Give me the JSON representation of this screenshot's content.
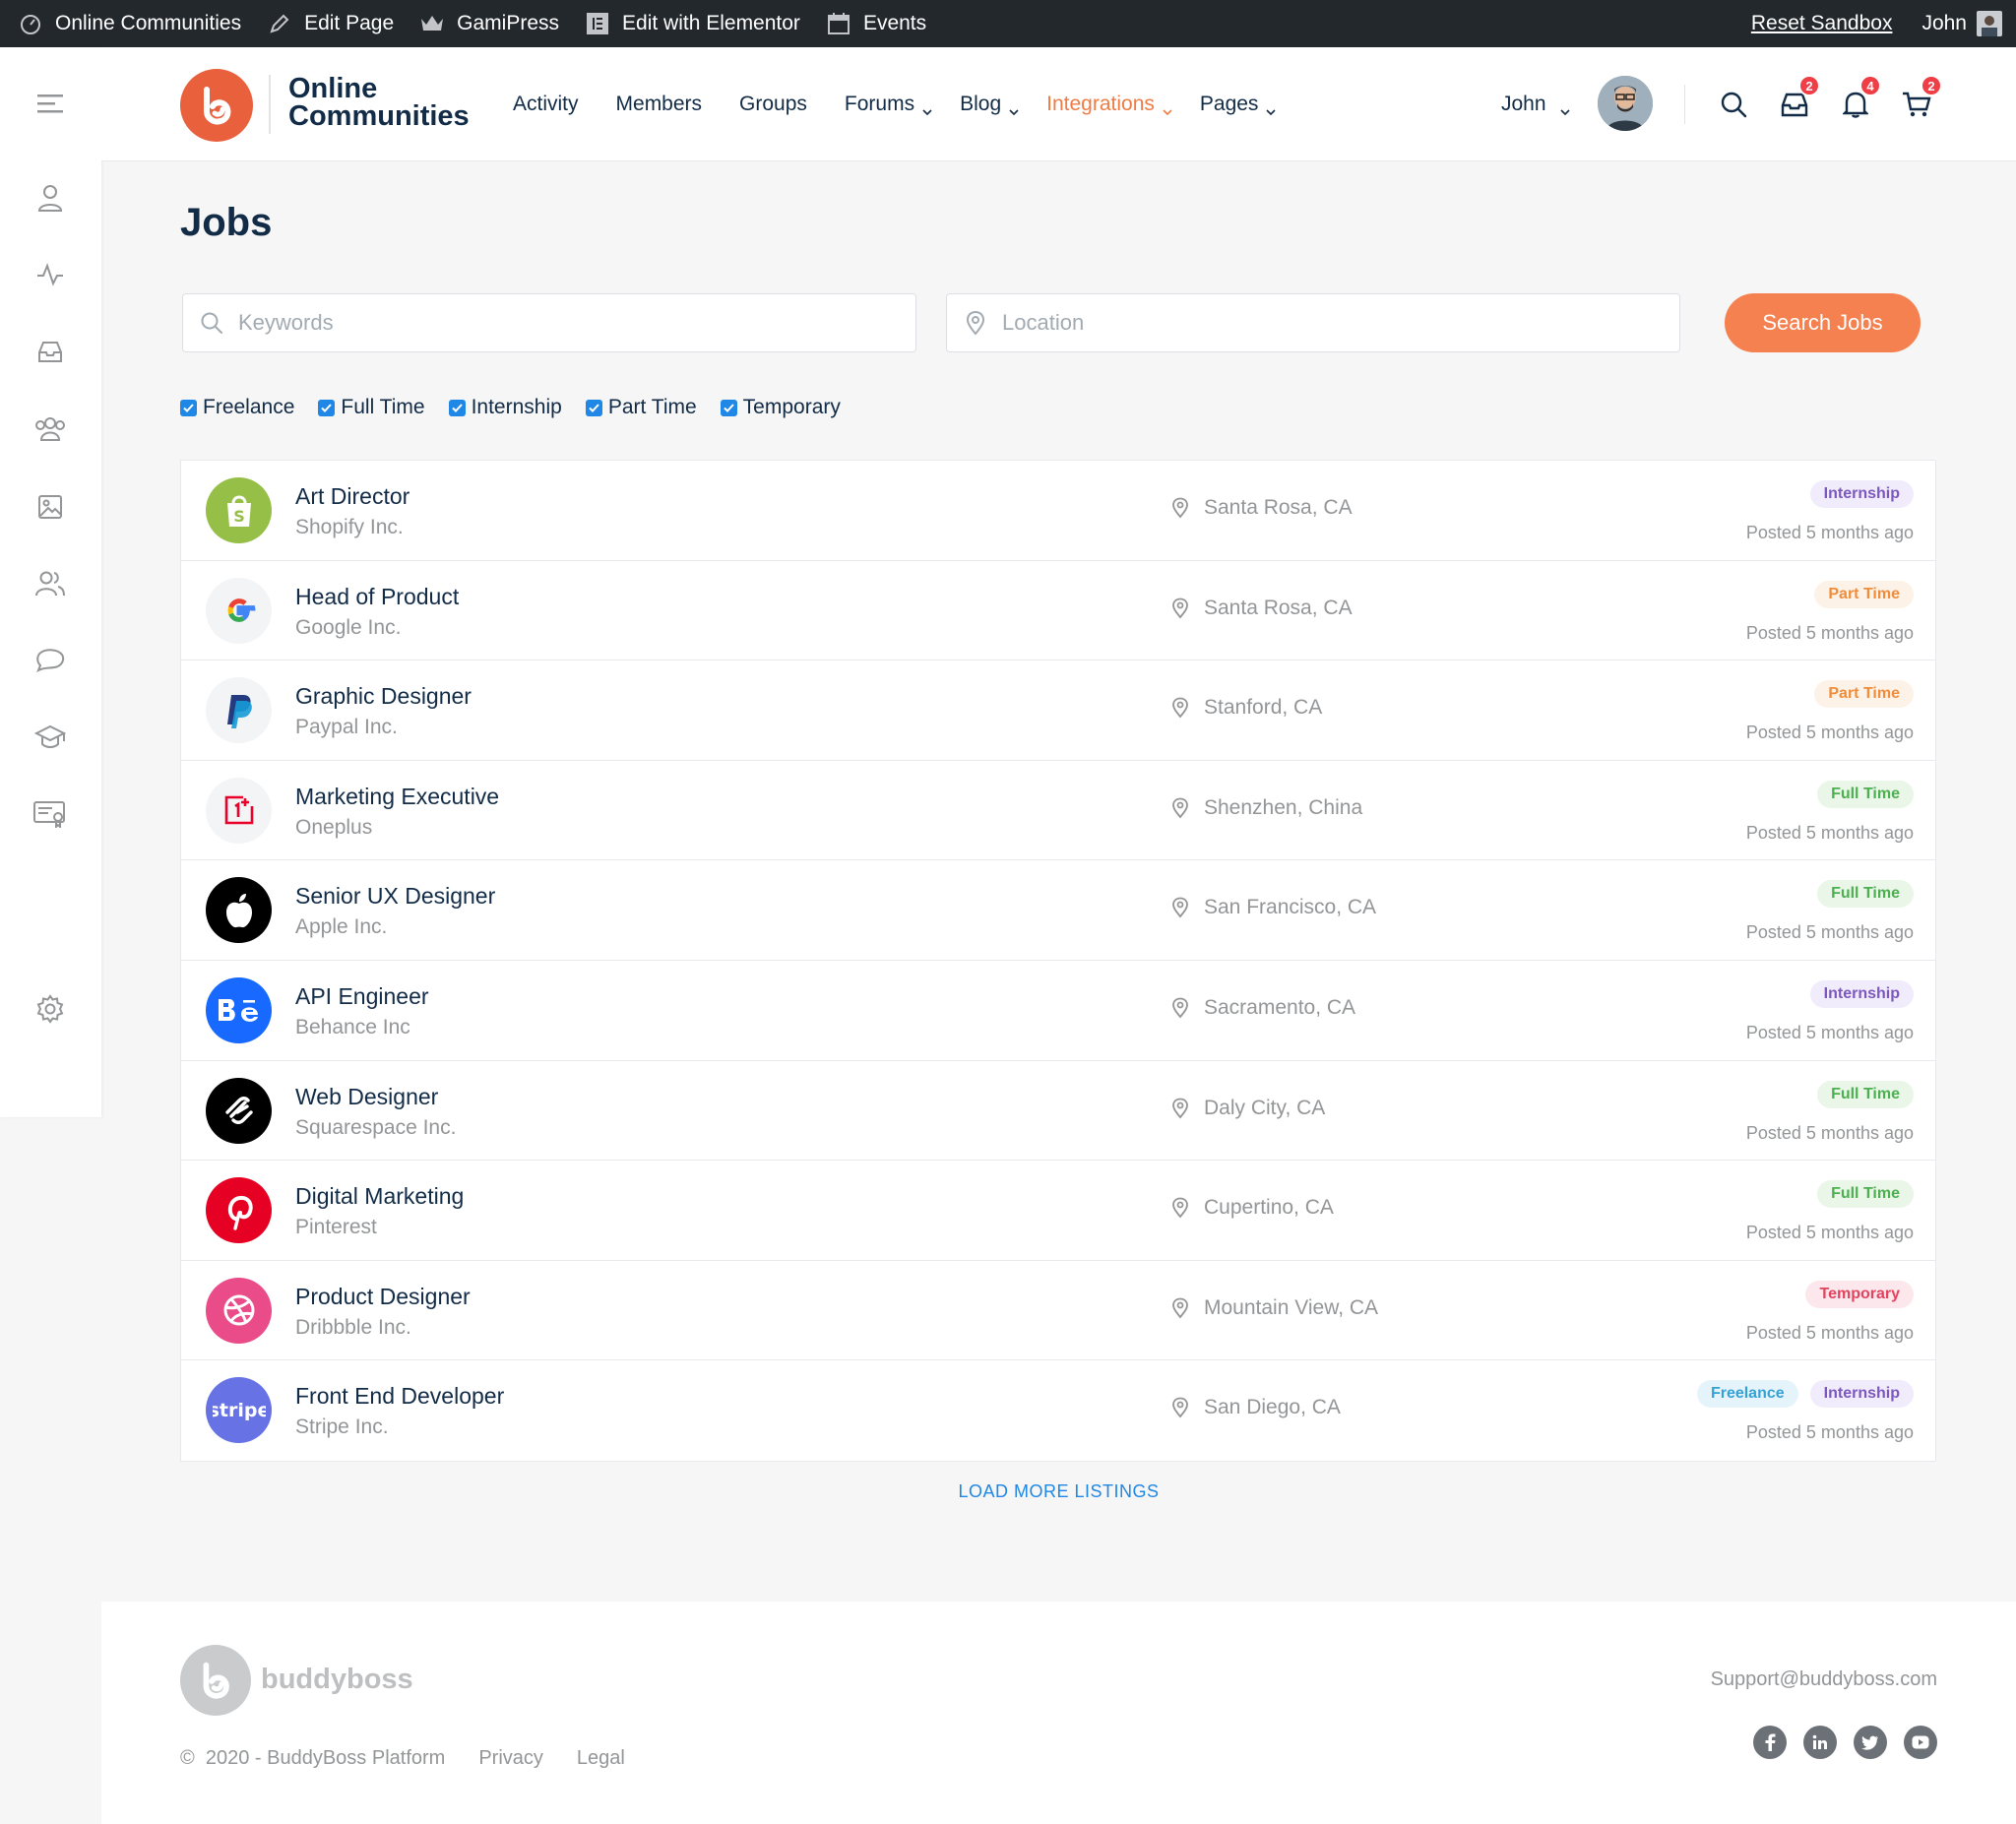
{
  "adminbar": {
    "site": "Online Communities",
    "edit_page": "Edit Page",
    "gamipress": "GamiPress",
    "elementor": "Edit with Elementor",
    "events": "Events",
    "reset": "Reset Sandbox",
    "user": "John"
  },
  "header": {
    "logo_line1": "Online",
    "logo_line2": "Communities",
    "nav": [
      {
        "label": "Activity"
      },
      {
        "label": "Members"
      },
      {
        "label": "Groups"
      },
      {
        "label": "Forums"
      },
      {
        "label": "Blog"
      },
      {
        "label": "Integrations"
      },
      {
        "label": "Pages"
      }
    ],
    "user": "John",
    "messages_count": "2",
    "notifications_count": "4",
    "cart_count": "2"
  },
  "page": {
    "title": "Jobs",
    "keywords_placeholder": "Keywords",
    "location_placeholder": "Location",
    "search_button": "Search Jobs",
    "filters": [
      "Freelance",
      "Full Time",
      "Internship",
      "Part Time",
      "Temporary"
    ],
    "load_more": "LOAD MORE LISTINGS"
  },
  "jobs": [
    {
      "title": "Art Director",
      "company": "Shopify Inc.",
      "location": "Santa Rosa, CA",
      "tags": [
        "Internship"
      ],
      "posted": "Posted 5 months ago"
    },
    {
      "title": "Head of Product",
      "company": "Google Inc.",
      "location": "Santa Rosa, CA",
      "tags": [
        "Part Time"
      ],
      "posted": "Posted 5 months ago"
    },
    {
      "title": "Graphic Designer",
      "company": "Paypal Inc.",
      "location": "Stanford, CA",
      "tags": [
        "Part Time"
      ],
      "posted": "Posted 5 months ago"
    },
    {
      "title": "Marketing Executive",
      "company": "Oneplus",
      "location": "Shenzhen, China",
      "tags": [
        "Full Time"
      ],
      "posted": "Posted 5 months ago"
    },
    {
      "title": "Senior UX Designer",
      "company": "Apple Inc.",
      "location": "San Francisco, CA",
      "tags": [
        "Full Time"
      ],
      "posted": "Posted 5 months ago"
    },
    {
      "title": "API Engineer",
      "company": "Behance Inc",
      "location": "Sacramento, CA",
      "tags": [
        "Internship"
      ],
      "posted": "Posted 5 months ago"
    },
    {
      "title": "Web Designer",
      "company": "Squarespace Inc.",
      "location": "Daly City, CA",
      "tags": [
        "Full Time"
      ],
      "posted": "Posted 5 months ago"
    },
    {
      "title": "Digital Marketing",
      "company": "Pinterest",
      "location": "Cupertino, CA",
      "tags": [
        "Full Time"
      ],
      "posted": "Posted 5 months ago"
    },
    {
      "title": "Product Designer",
      "company": "Dribbble Inc.",
      "location": "Mountain View, CA",
      "tags": [
        "Temporary"
      ],
      "posted": "Posted 5 months ago"
    },
    {
      "title": "Front End Developer",
      "company": "Stripe Inc.",
      "location": "San Diego, CA",
      "tags": [
        "Freelance",
        "Internship"
      ],
      "posted": "Posted 5 months ago"
    }
  ],
  "footer": {
    "brand": "buddyboss",
    "copyright": "2020 - BuddyBoss Platform",
    "privacy": "Privacy",
    "legal": "Legal",
    "email": "Support@buddyboss.com",
    "social": [
      "facebook-icon",
      "linkedin-icon",
      "twitter-icon",
      "youtube-icon"
    ]
  },
  "colors": {
    "accent": "#f4814f",
    "nav_active": "#ef7c44",
    "link": "#1f87e5",
    "text": "#122b46"
  }
}
